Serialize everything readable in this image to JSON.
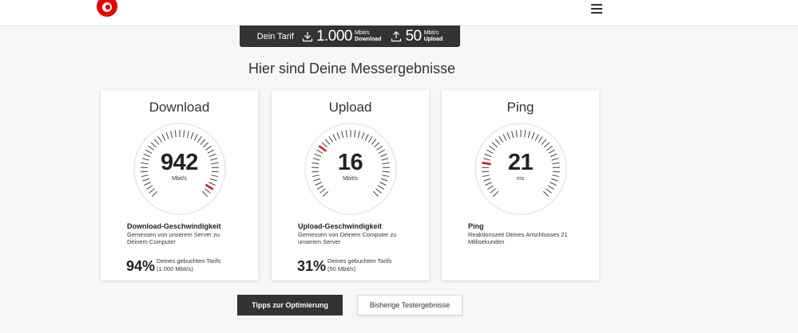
{
  "brand": {
    "accent": "#e60000",
    "dark": "#333333"
  },
  "header": {
    "logo_icon": "vodafone-logo-icon",
    "menu_icon": "hamburger-menu-icon"
  },
  "tarif": {
    "label": "Dein Tarif",
    "download_value": "1.000",
    "download_unit": "Mbit/s",
    "download_caption": "Download",
    "upload_value": "50",
    "upload_unit": "Mbit/s",
    "upload_caption": "Upload"
  },
  "title": "Hier sind Deine Messergebnisse",
  "cards": [
    {
      "title": "Download",
      "value": "942",
      "unit": "Mbit/s",
      "needle_fraction": 0.94,
      "desc_title": "Download-Geschwindigkeit",
      "desc_text": "Gemessen von unserem Server zu Deinem Computer",
      "percent": "94%",
      "percent_text_1": "Deines gebuchten Tarifs",
      "percent_text_2": "(1.000 Mbit/s)"
    },
    {
      "title": "Upload",
      "value": "16",
      "unit": "Mbit/s",
      "needle_fraction": 0.31,
      "desc_title": "Upload-Geschwindigkeit",
      "desc_text": "Gemessen von Deinem Computer zu unserem Server",
      "percent": "31%",
      "percent_text_1": "Deines gebuchten Tarifs",
      "percent_text_2": "(50 Mbit/s)"
    },
    {
      "title": "Ping",
      "value": "21",
      "unit": "ms",
      "needle_fraction": 0.21,
      "desc_title": "Ping",
      "desc_text": "Reaktionszeit Deines Anschlusses 21 Millisekunden"
    }
  ],
  "buttons": {
    "tips": "Tipps zur Optimierung",
    "history": "Bisherige Testergebnisse"
  }
}
